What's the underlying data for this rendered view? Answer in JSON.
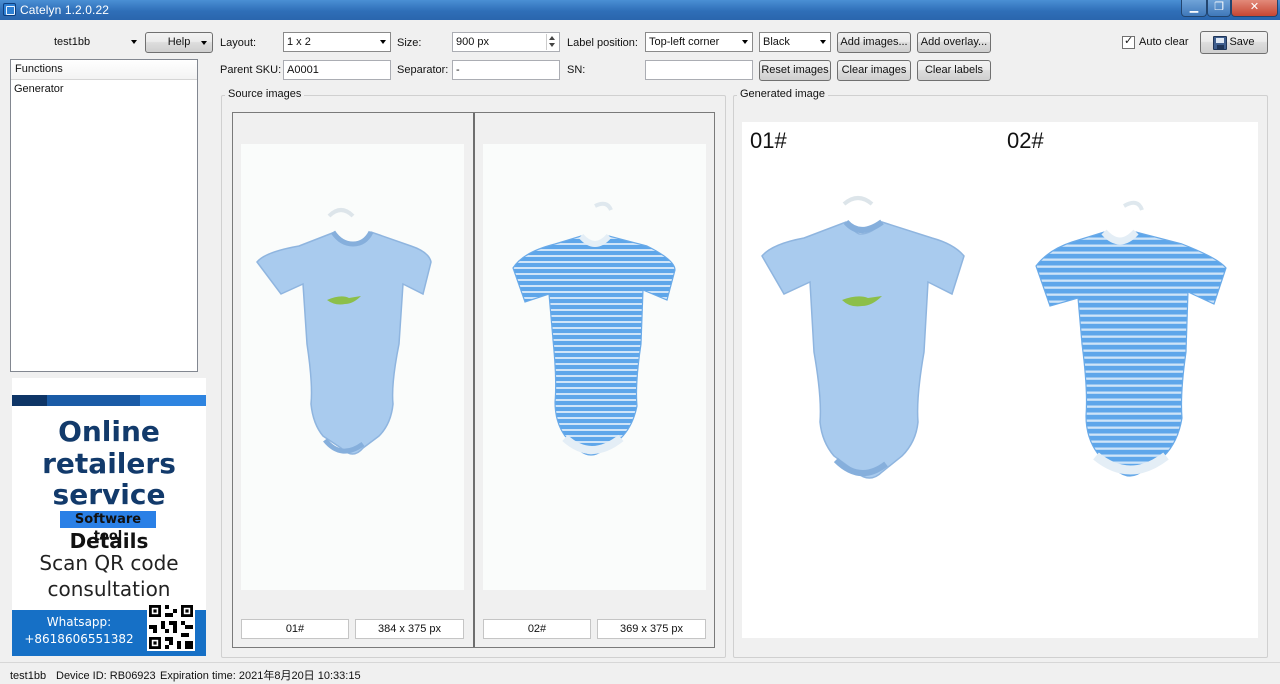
{
  "window": {
    "title": "Catelyn 1.2.0.22",
    "controls": [
      "minimize",
      "restore",
      "close"
    ]
  },
  "toolbar": {
    "user_select": "test1bb",
    "help_label": "Help",
    "layout_label": "Layout:",
    "layout_value": "1 x 2",
    "size_label": "Size:",
    "size_value": "900 px",
    "label_position_label": "Label position:",
    "label_position_value": "Top-left corner",
    "label_color_value": "Black",
    "add_images_label": "Add images...",
    "add_overlay_label": "Add overlay...",
    "auto_clear_label": "Auto clear",
    "auto_clear_checked": true,
    "save_label": "Save",
    "parent_sku_label": "Parent SKU:",
    "parent_sku_value": "A0001",
    "separator_label": "Separator:",
    "separator_value": "-",
    "sn_label": "SN:",
    "sn_value": "",
    "reset_images_label": "Reset images",
    "clear_images_label": "Clear images",
    "clear_labels_label": "Clear labels"
  },
  "functions": {
    "header": "Functions",
    "items": [
      "Generator"
    ]
  },
  "ad": {
    "line1": "Online",
    "line2": "retailers",
    "line3": "service",
    "line4": "Software tool",
    "line5": "Details",
    "line6": "Scan QR code",
    "line7": "consultation",
    "whatsapp_label": "Whatsapp:",
    "whatsapp_number": "+8618606551382"
  },
  "source": {
    "title": "Source images",
    "slots": [
      {
        "label": "01#",
        "dimensions": "384 x 375 px",
        "image": "light-blue-onesie-crocodile"
      },
      {
        "label": "02#",
        "dimensions": "369 x 375 px",
        "image": "blue-striped-onesie"
      }
    ]
  },
  "generated": {
    "title": "Generated image",
    "labels": [
      "01#",
      "02#"
    ]
  },
  "status": {
    "user": "test1bb",
    "device": "Device ID: RB06923",
    "expiration": "Expiration time: 2021年8月20日 10:33:15"
  },
  "colors": {
    "onesie_blue": "#a9cbee",
    "stripe_blue": "#5ea6ea",
    "titlebar": "#2f6fb8",
    "ad_blue": "#1670c6"
  }
}
